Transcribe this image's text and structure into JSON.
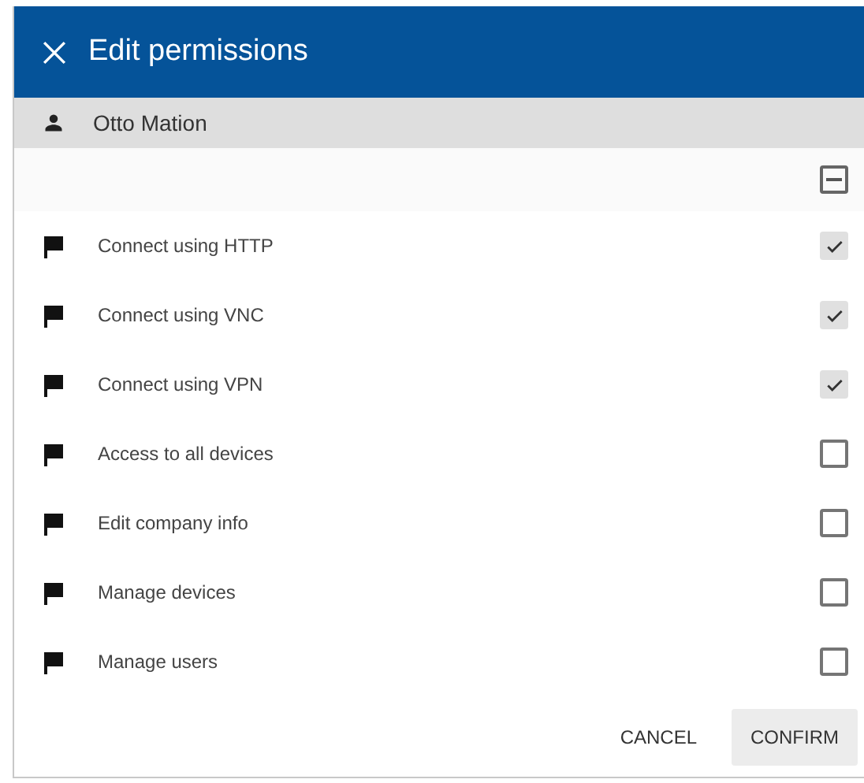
{
  "dialog": {
    "title": "Edit permissions"
  },
  "user": {
    "name": "Otto Mation"
  },
  "select_all": {
    "indeterminate": true
  },
  "permissions": [
    {
      "label": "Connect using HTTP",
      "checked": true
    },
    {
      "label": "Connect using VNC",
      "checked": true
    },
    {
      "label": "Connect using VPN",
      "checked": true
    },
    {
      "label": "Access to all devices",
      "checked": false
    },
    {
      "label": "Edit company info",
      "checked": false
    },
    {
      "label": "Manage devices",
      "checked": false
    },
    {
      "label": "Manage users",
      "checked": false
    }
  ],
  "buttons": [
    {
      "label": "CANCEL",
      "kind": "text"
    },
    {
      "label": "CONFIRM",
      "kind": "filled"
    }
  ]
}
